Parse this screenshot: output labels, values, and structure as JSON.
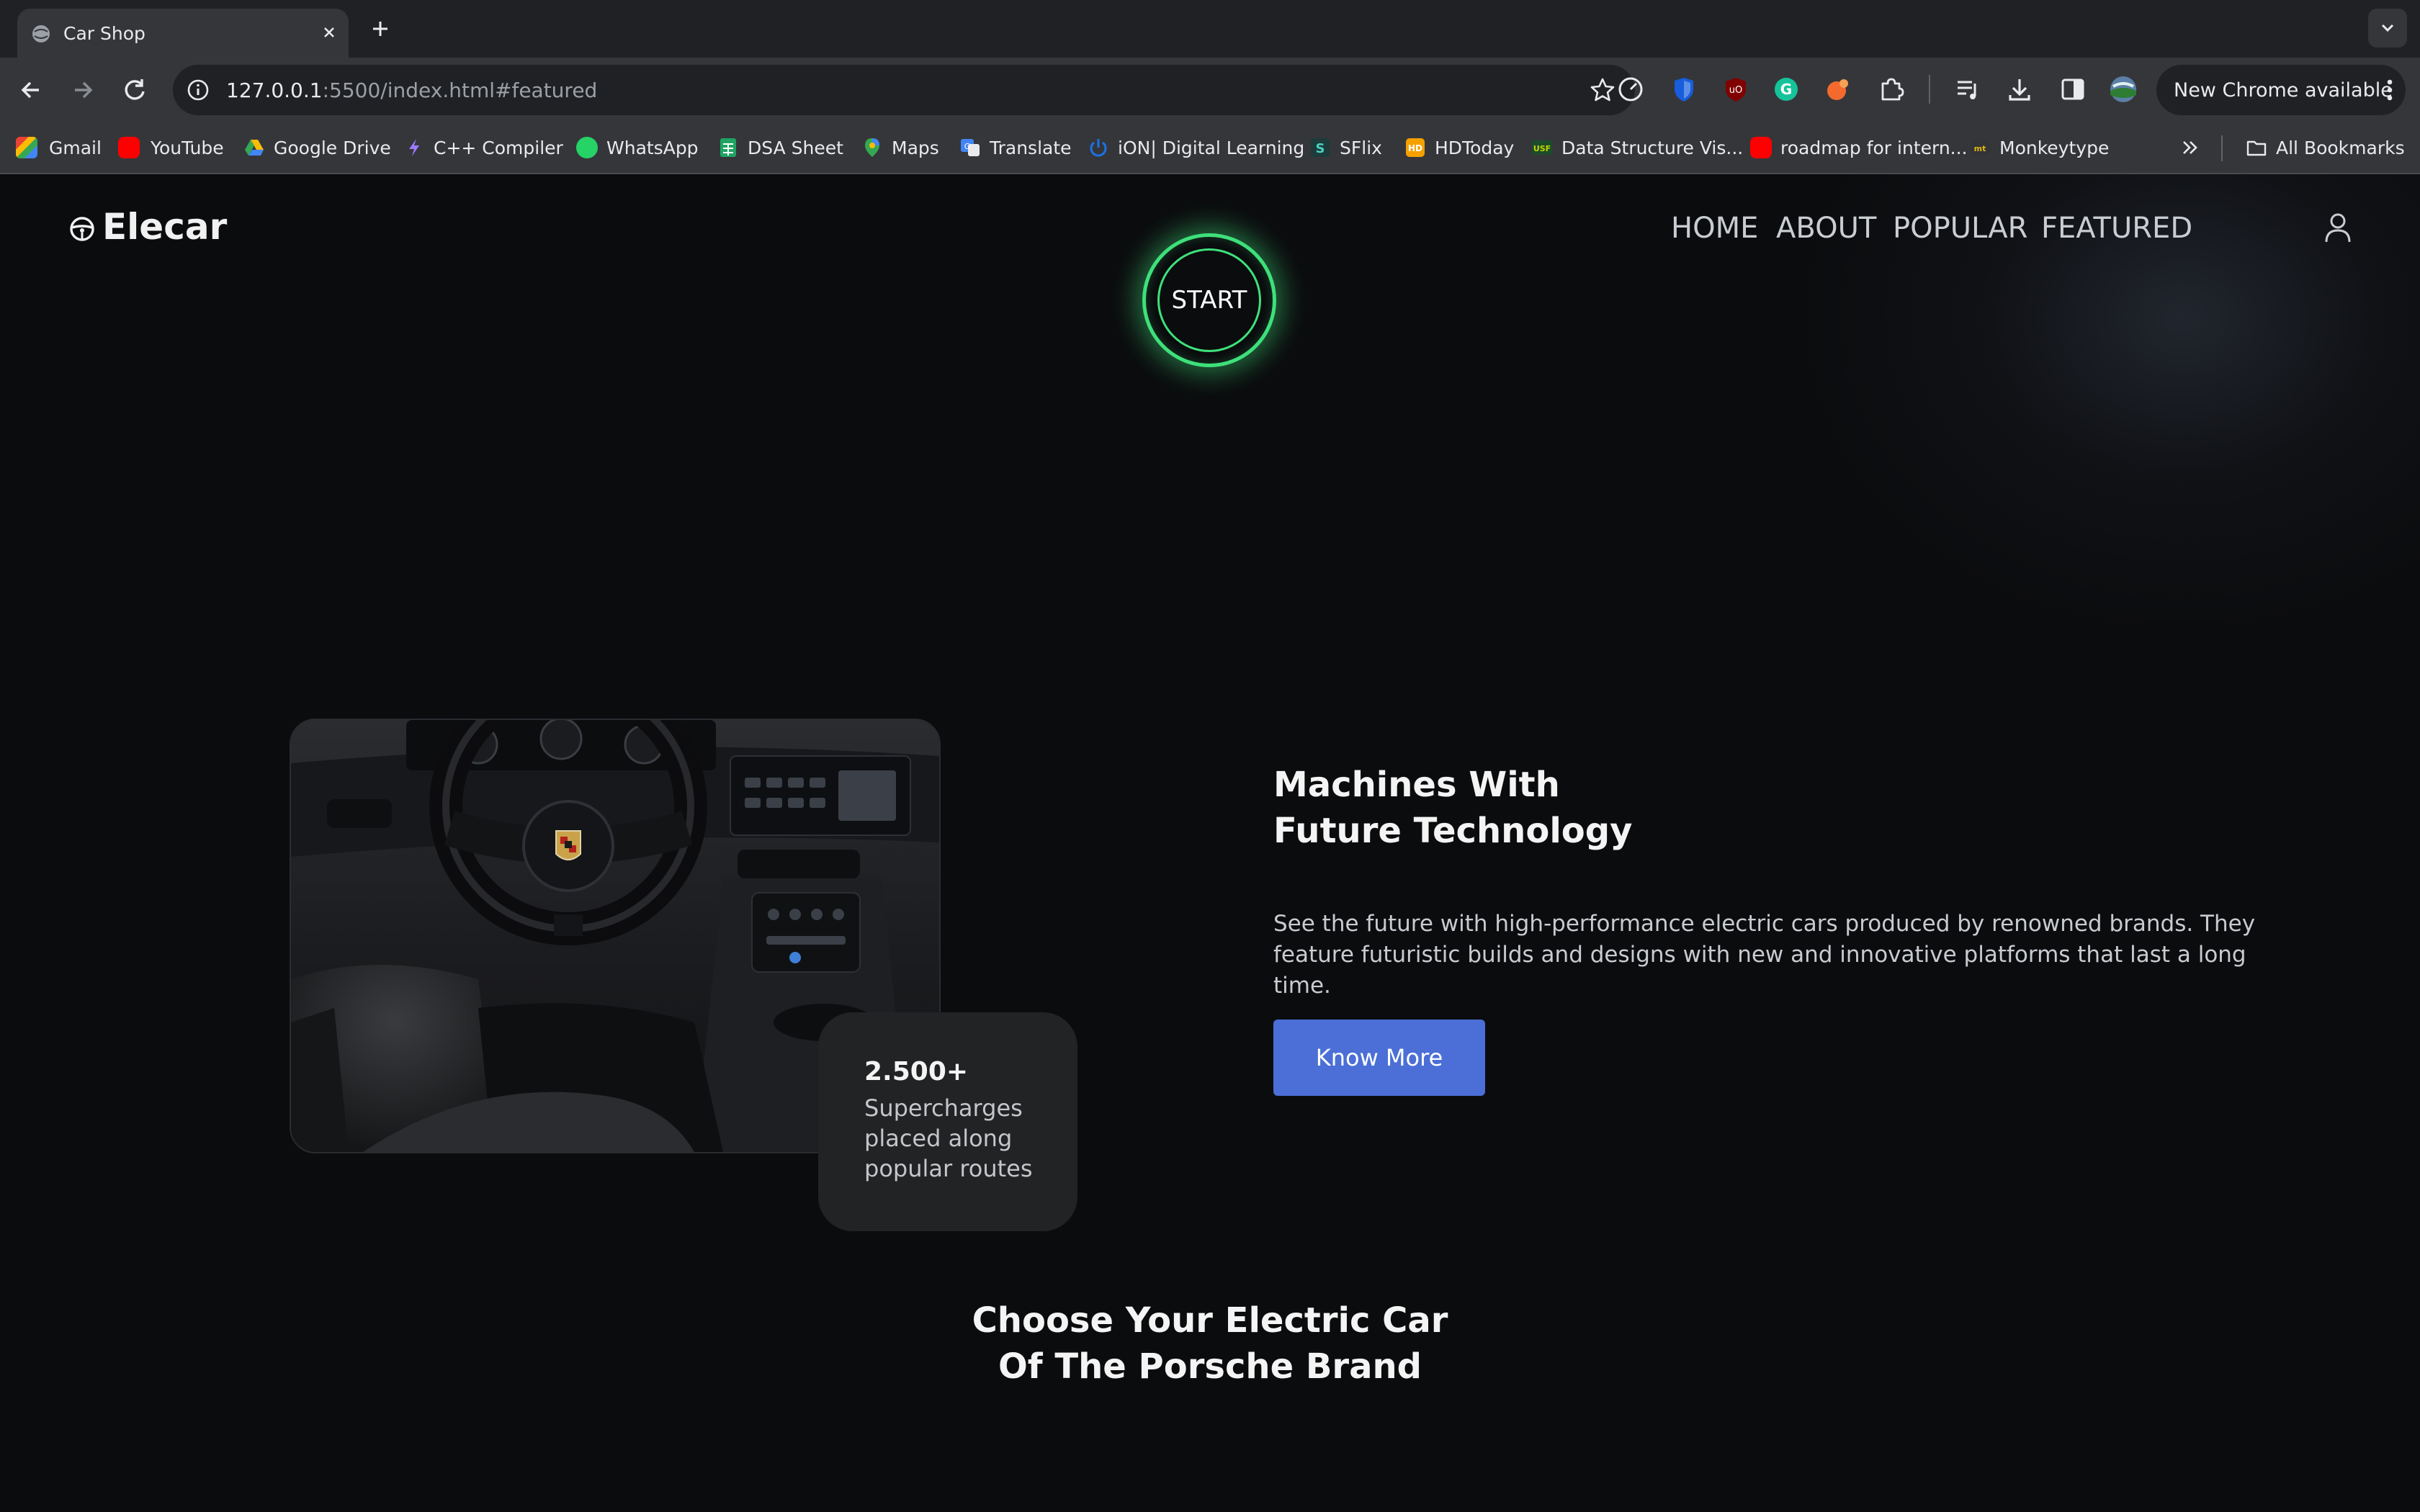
{
  "browser": {
    "tab": {
      "title": "Car Shop"
    },
    "url": {
      "host": "127.0.0.1",
      "rest": ":5500/index.html#featured"
    },
    "update_label": "New Chrome available",
    "bookmarks": [
      {
        "label": "Gmail",
        "icon": "gmail-icon",
        "color": "#ea4335"
      },
      {
        "label": "YouTube",
        "icon": "youtube-icon",
        "color": "#ff0000"
      },
      {
        "label": "Google Drive",
        "icon": "drive-icon",
        "color": "#34a853"
      },
      {
        "label": "C++ Compiler",
        "icon": "bolt-icon",
        "color": "#7c4dff"
      },
      {
        "label": "WhatsApp",
        "icon": "whatsapp-icon",
        "color": "#25d366"
      },
      {
        "label": "DSA Sheet",
        "icon": "sheet-icon",
        "color": "#1fa463"
      },
      {
        "label": "Maps",
        "icon": "maps-icon",
        "color": "#fbbc04"
      },
      {
        "label": "Translate",
        "icon": "translate-icon",
        "color": "#4285f4"
      },
      {
        "label": "iON| Digital Learning",
        "icon": "power-icon",
        "color": "#1a73e8"
      },
      {
        "label": "SFlix",
        "icon": "sflix-icon",
        "color": "#26a69a"
      },
      {
        "label": "HDToday",
        "icon": "hd-icon",
        "color": "#f4a100"
      },
      {
        "label": "Data Structure Vis...",
        "icon": "usf-icon",
        "color": "#c6d300"
      },
      {
        "label": "roadmap for intern...",
        "icon": "youtube-icon",
        "color": "#ff0000"
      },
      {
        "label": "Monkeytype",
        "icon": "monkeytype-icon",
        "color": "#e2b714"
      }
    ],
    "all_bookmarks": "All Bookmarks"
  },
  "site": {
    "logo": "Elecar",
    "nav": [
      "HOME",
      "ABOUT",
      "POPULAR",
      "FEATURED"
    ],
    "start_label": "START",
    "accent_green": "#3ee07a",
    "button_blue": "#4b6fd6"
  },
  "hero": {
    "title_line1": "Machines With",
    "title_line2": "Future Technology",
    "description": "See the future with high-performance electric cars produced by renowned brands. They feature futuristic builds and designs with new and innovative platforms that last a long time.",
    "button": "Know More",
    "stat_number": "2.500+",
    "stat_text": "Supercharges placed along popular routes"
  },
  "section": {
    "title_line1": "Choose Your Electric Car",
    "title_line2": "Of The Porsche Brand"
  }
}
